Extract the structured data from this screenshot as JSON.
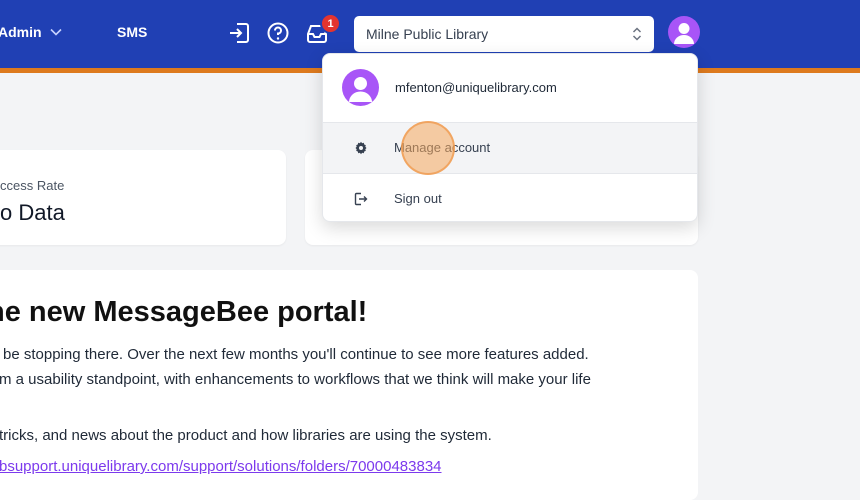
{
  "header": {
    "admin_label": "Admin",
    "sms_label": "SMS",
    "notification_count": "1",
    "library_select": {
      "value": "Milne Public Library"
    }
  },
  "user_menu": {
    "email": "mfenton@uniquelibrary.com",
    "items": [
      {
        "label": "Manage account",
        "icon": "gear-icon"
      },
      {
        "label": "Sign out",
        "icon": "sign-out-icon"
      }
    ]
  },
  "stats": {
    "card1_label": "ccess Rate",
    "card1_value": "o Data"
  },
  "welcome": {
    "title": "ne new MessageBee portal!",
    "line1": "be stopping there.  Over the next few months you'll continue to see more features added.",
    "line2": "m a usability standpoint, with enhancements to workflows that we think will make your life",
    "line3": "tricks, and news about the product and how libraries are using the system.",
    "link": "bsupport.uniquelibrary.com/support/solutions/folders/70000483834"
  },
  "colors": {
    "topbar": "#2040b4",
    "accent_stripe": "#dd7a1e",
    "avatar": "#a855f7",
    "badge": "#e3342f"
  }
}
